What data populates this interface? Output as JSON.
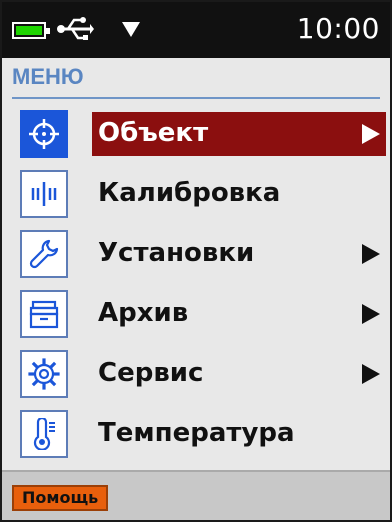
{
  "status_bar": {
    "time": "10:00",
    "icons": [
      "battery-icon",
      "usb-icon",
      "signal-icon"
    ],
    "battery_color": "#1ed400"
  },
  "menu": {
    "title": "МЕНЮ",
    "items": [
      {
        "label": "Объект",
        "icon": "target-icon",
        "has_submenu": true,
        "selected": true
      },
      {
        "label": "Калибровка",
        "icon": "calibration-icon",
        "has_submenu": false,
        "selected": false
      },
      {
        "label": "Установки",
        "icon": "wrench-icon",
        "has_submenu": true,
        "selected": false
      },
      {
        "label": "Архив",
        "icon": "archive-icon",
        "has_submenu": true,
        "selected": false
      },
      {
        "label": "Сервис",
        "icon": "gear-icon",
        "has_submenu": true,
        "selected": false
      },
      {
        "label": "Температура",
        "icon": "thermometer-icon",
        "has_submenu": false,
        "selected": false
      }
    ]
  },
  "bottom_bar": {
    "help_label": "Помощь"
  },
  "colors": {
    "selected_row": "#8b0f0f",
    "selected_icon": "#1b56d9",
    "title": "#5a86c2",
    "help_button": "#e85f0c"
  }
}
